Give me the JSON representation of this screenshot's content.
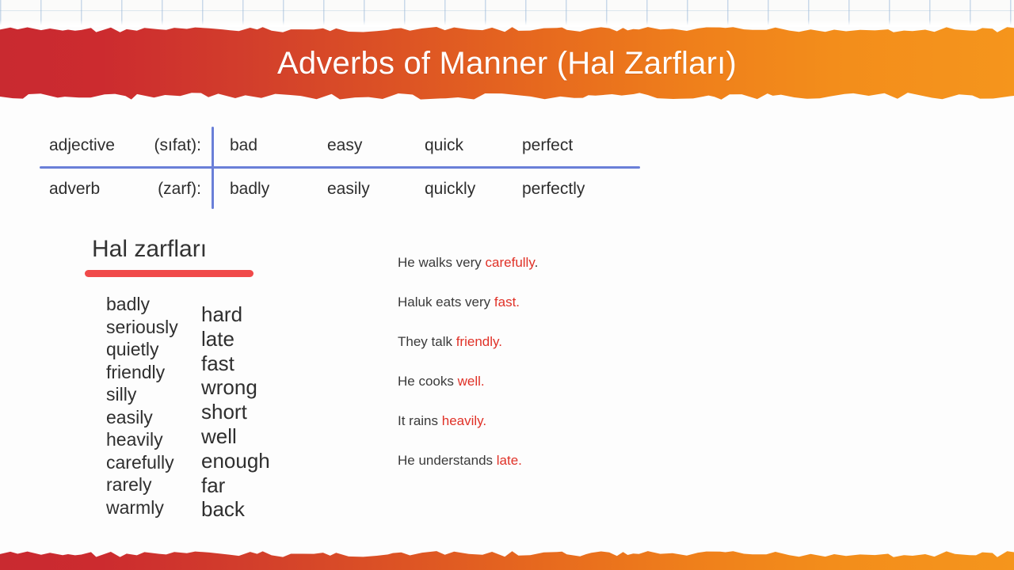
{
  "banner": {
    "title": "Adverbs of Manner (Hal Zarfları)",
    "color_left": "#c92a30",
    "color_right": "#f5951c"
  },
  "table": {
    "divider_color": "#6a7fd8",
    "rows": [
      {
        "label_main": "adjective",
        "label_paren": "(sıfat):",
        "words": [
          "bad",
          "easy",
          "quick",
          "perfect"
        ]
      },
      {
        "label_main": "adverb",
        "label_paren": "(zarf):",
        "words": [
          "badly",
          "easily",
          "quickly",
          "perfectly"
        ]
      }
    ]
  },
  "heading": {
    "text": "Hal zarfları",
    "rule_color": "#f04a4a"
  },
  "word_lists": {
    "column_one": [
      "badly",
      "seriously",
      "quietly",
      "friendly",
      "silly",
      "easily",
      "heavily",
      "carefully",
      "rarely",
      "warmly"
    ],
    "column_two": [
      "hard",
      "late",
      "fast",
      "wrong",
      "short",
      "well",
      "enough",
      "far",
      "back"
    ]
  },
  "examples": {
    "highlight_color": "#e03127",
    "sentences": [
      {
        "before": "He walks very ",
        "highlight": "carefully",
        "after": "."
      },
      {
        "before": "Haluk eats very ",
        "highlight": "fast.",
        "after": ""
      },
      {
        "before": "They talk ",
        "highlight": "friendly.",
        "after": ""
      },
      {
        "before": "He cooks ",
        "highlight": "well.",
        "after": ""
      },
      {
        "before": "It rains ",
        "highlight": "heavily.",
        "after": ""
      },
      {
        "before": "He understands ",
        "highlight": "late.",
        "after": ""
      }
    ]
  }
}
